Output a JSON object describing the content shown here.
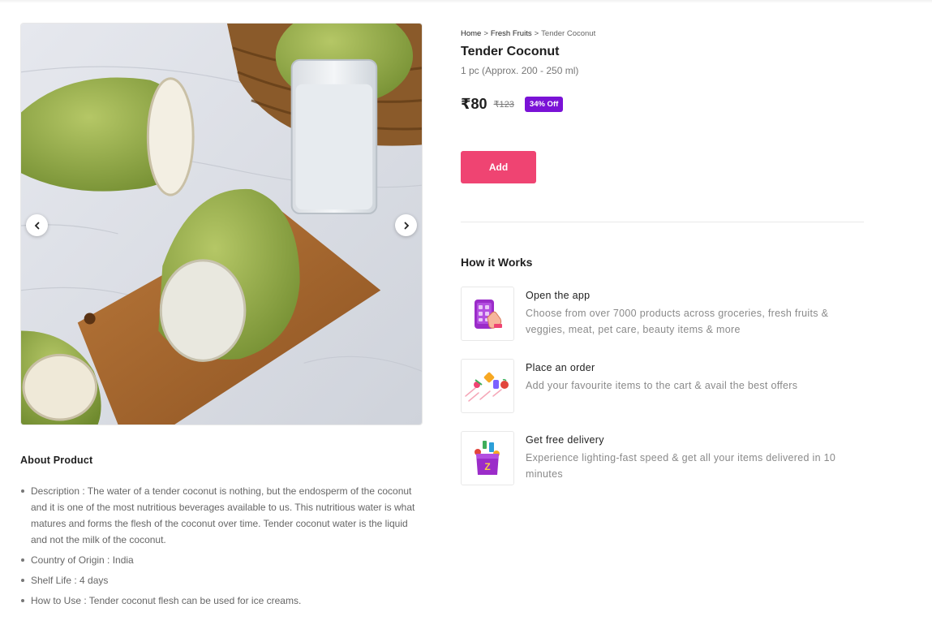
{
  "product": {
    "breadcrumb": {
      "home": "Home",
      "category": "Fresh Fruits",
      "current": "Tender Coconut",
      "separator": ">"
    },
    "title": "Tender Coconut",
    "quantity": "1 pc (Approx. 200 - 250 ml)",
    "price": "₹80",
    "mrp": "₹123",
    "discount": "34% Off",
    "add_label": "Add",
    "colors": {
      "accent": "#ef4472",
      "discount_badge": "#7a12d6"
    }
  },
  "gallery": {
    "prev_icon": "chevron-left-icon",
    "next_icon": "chevron-right-icon"
  },
  "about": {
    "heading": "About Product",
    "items": [
      "Description : The water of a tender coconut is nothing, but the endosperm of the coconut and it is one of the most nutritious beverages available to us. This nutritious water is what matures and forms the flesh of the coconut over time. Tender coconut water is the liquid and not the milk of the coconut.",
      "Country of Origin : India",
      "Shelf Life : 4 days",
      "How to Use : Tender coconut flesh can be used for ice creams."
    ]
  },
  "how_it_works": {
    "heading": "How it Works",
    "steps": [
      {
        "title": "Open the app",
        "description": "Choose from over 7000 products across groceries, fresh fruits & veggies, meat, pet care, beauty items & more",
        "icon": "phone-tap-icon"
      },
      {
        "title": "Place an order",
        "description": "Add your favourite items to the cart & avail the best offers",
        "icon": "flying-products-icon"
      },
      {
        "title": "Get free delivery",
        "description": "Experience lighting-fast speed & get all your items delivered in 10 minutes",
        "icon": "grocery-bag-icon"
      }
    ]
  }
}
